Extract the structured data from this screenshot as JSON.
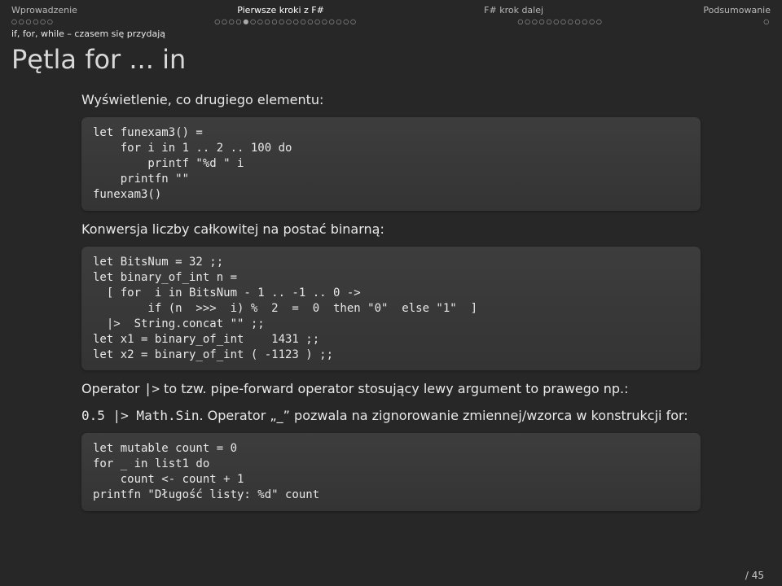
{
  "nav": [
    {
      "label": "Wprowadzenie",
      "dots": "○○○○○○",
      "active": false
    },
    {
      "label": "Pierwsze kroki z F#",
      "dots": "○○○○●○○○○○○○○○○○○○○○",
      "active": true
    },
    {
      "label": "F# krok dalej",
      "dots": "○○○○○○○○○○○○",
      "active": false
    },
    {
      "label": "Podsumowanie",
      "dots": "○",
      "active": false
    }
  ],
  "subhead": "if, for, while – czasem się przydają",
  "title": "Pętla for ... in",
  "p1": "Wyświetlenie, co drugiego elementu:",
  "code1": "let funexam3() =\n    for i in 1 .. 2 .. 100 do\n        printf \"%d \" i\n    printfn \"\"\nfunexam3()",
  "p2": "Konwersja liczby całkowitej na postać binarną:",
  "code2": "let BitsNum = 32 ;;\nlet binary_of_int n =\n  [ for  i in BitsNum - 1 .. -1 .. 0 ->\n        if (n  >>>  i) %  2  =  0  then \"0\"  else \"1\"  ]\n  |>  String.concat \"\" ;;\nlet x1 = binary_of_int    1431 ;;\nlet x2 = binary_of_int ( -1123 ) ;;",
  "p3_pre": "Operator ",
  "p3_op": "|>",
  "p3_mid": " to tzw. pipe-forward operator stosujący lewy argument to prawego np.:",
  "p4_pre": "0.5 |> Math.Sin",
  "p4_post": ". Operator „_” pozwala na zignorowanie zmiennej/wzorca w konstrukcji for:",
  "code3": "let mutable count = 0\nfor _ in list1 do\n    count <- count + 1\nprintfn \"Długość listy: %d\" count",
  "footer": "    / 45"
}
